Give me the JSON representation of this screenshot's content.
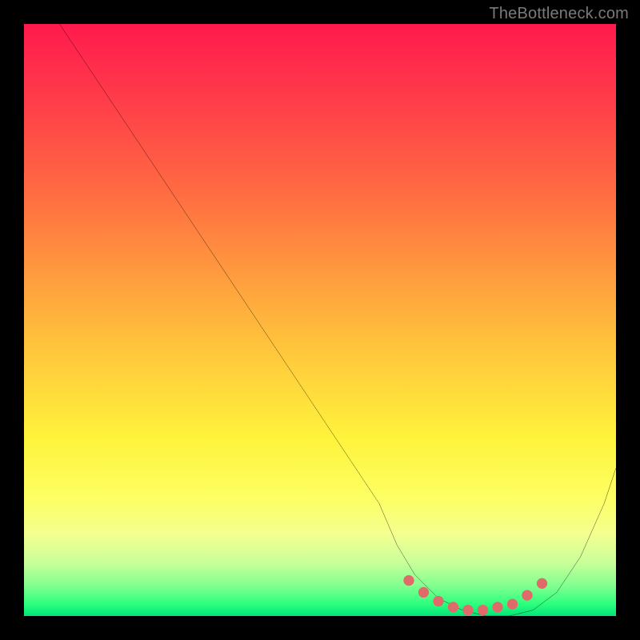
{
  "watermark": "TheBottleneck.com",
  "chart_data": {
    "type": "line",
    "title": "",
    "xlabel": "",
    "ylabel": "",
    "xlim": [
      0,
      100
    ],
    "ylim": [
      0,
      100
    ],
    "series": [
      {
        "name": "bottleneck-curve",
        "x": [
          6,
          12,
          18,
          24,
          30,
          36,
          42,
          48,
          54,
          60,
          63,
          66,
          70,
          74,
          78,
          82,
          86,
          90,
          94,
          98,
          100
        ],
        "y": [
          100,
          91,
          82,
          73,
          64,
          55,
          46,
          37,
          28,
          19,
          12,
          7,
          3,
          1,
          0,
          0,
          1,
          4,
          10,
          19,
          25
        ]
      }
    ],
    "markers": {
      "name": "optimal-zone-dots",
      "color": "#e06a6a",
      "x": [
        65,
        67.5,
        70,
        72.5,
        75,
        77.5,
        80,
        82.5,
        85,
        87.5
      ],
      "y": [
        6,
        4,
        2.5,
        1.5,
        1,
        1,
        1.5,
        2,
        3.5,
        5.5
      ]
    },
    "gradient_stops": [
      {
        "pos": 0,
        "color": "#ff1a4d"
      },
      {
        "pos": 12,
        "color": "#ff3a4a"
      },
      {
        "pos": 28,
        "color": "#ff6a42"
      },
      {
        "pos": 42,
        "color": "#ff9a3e"
      },
      {
        "pos": 56,
        "color": "#ffc93c"
      },
      {
        "pos": 70,
        "color": "#fff33c"
      },
      {
        "pos": 80,
        "color": "#fdff63"
      },
      {
        "pos": 86,
        "color": "#f5ff8f"
      },
      {
        "pos": 91,
        "color": "#c9ff9a"
      },
      {
        "pos": 95,
        "color": "#7fff8f"
      },
      {
        "pos": 98,
        "color": "#2cff7e"
      },
      {
        "pos": 100,
        "color": "#00e676"
      }
    ]
  }
}
